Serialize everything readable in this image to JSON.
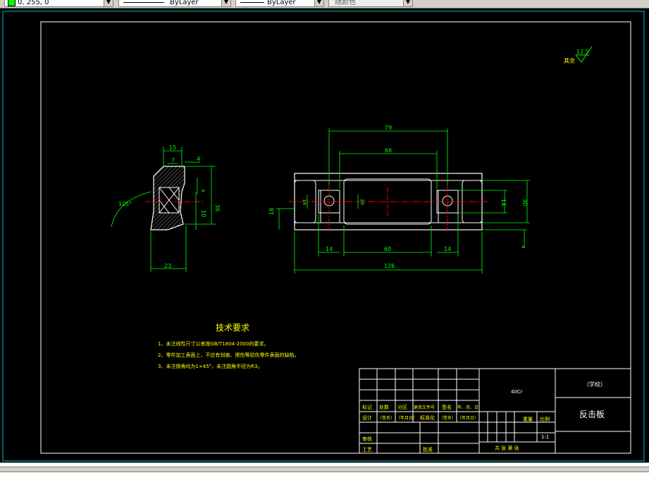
{
  "toolbar": {
    "color_value": "0, 255, 0",
    "linetype_value": "ByLayer",
    "lineweight_value": "ByLayer",
    "plotstyle_value": "随颜色"
  },
  "drawing": {
    "surface_finish": {
      "label": "其余",
      "value": "12.5"
    },
    "side_view": {
      "dims": [
        "15",
        "7",
        "4",
        "36",
        "10",
        "4",
        "23"
      ],
      "angle": "105°"
    },
    "front_view": {
      "dims": [
        "79",
        "66",
        "26",
        "14",
        "18",
        "14",
        "60",
        "14",
        "126",
        "14",
        "30",
        "4"
      ]
    },
    "tech_req": {
      "title": "技术要求",
      "lines": [
        "1、未注线性尺寸公差按GB/T1804-2000的要求。",
        "2、零件加工表面上，不应有划痕、擦伤等损伤零件表面的缺陷。",
        "3、未注倒角均为1×45°，未注圆角半径为R3。"
      ]
    },
    "title_block": {
      "material": "40Cr",
      "school": "（学校）",
      "part_name": "反击板",
      "scale": "1:1",
      "header_row": [
        "标记",
        "处数",
        "分区",
        "更改文件号",
        "签名",
        "年、月、日"
      ],
      "design_row": [
        "设计",
        "（签名）",
        "（年月日）",
        "标准化",
        "（签名）",
        "（年月日）"
      ],
      "review": "审核",
      "process": "工艺",
      "approve": "批准",
      "weight": "重量",
      "ratio": "比例",
      "sheets": "共   张   第   张"
    }
  }
}
